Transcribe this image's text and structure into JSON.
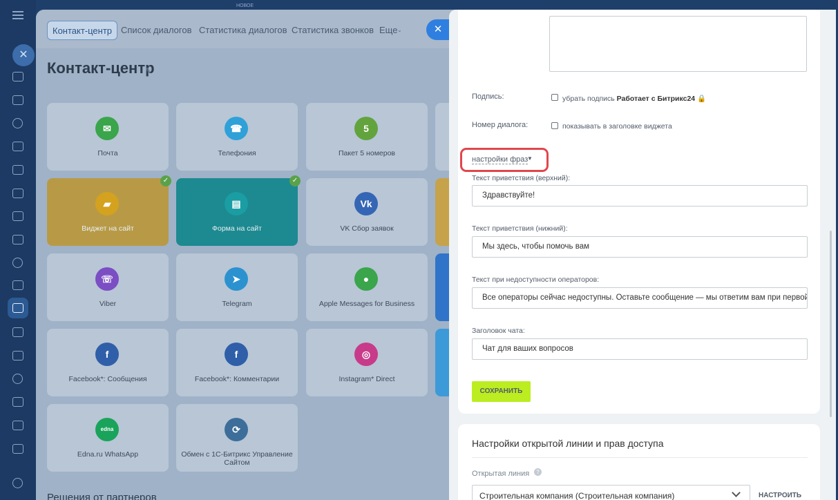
{
  "top_badge": "НОВОЕ",
  "tabs": [
    {
      "label": "Контакт-центр"
    },
    {
      "label": "Список диалогов"
    },
    {
      "label": "Статистика диалогов"
    },
    {
      "label": "Статистика звонков"
    },
    {
      "label": "Еще"
    }
  ],
  "page_title": "Контакт-центр",
  "tiles": [
    {
      "label": "Почта",
      "icon": "mail-icon",
      "icon_glyph": "✉",
      "color": "#3aa54a"
    },
    {
      "label": "Телефония",
      "icon": "phone-icon",
      "icon_glyph": "☎",
      "color": "#2fa0d8"
    },
    {
      "label": "Пакет 5 номеров",
      "icon": "numbers-package-icon",
      "icon_glyph": "5",
      "color": "#62a33e"
    },
    {
      "label": "Виджет на сайт",
      "icon": "chat-widget-icon",
      "icon_glyph": "▰",
      "color": "#d4a21e",
      "checked": true
    },
    {
      "label": "Форма на сайт",
      "icon": "form-icon",
      "icon_glyph": "▤",
      "color": "#1a9da3",
      "checked": true
    },
    {
      "label": "VK Сбор заявок",
      "icon": "vk-icon",
      "icon_glyph": "Vk",
      "color": "#3566b5"
    },
    {
      "label": "Viber",
      "icon": "viber-icon",
      "icon_glyph": "☏",
      "color": "#7b4ec4"
    },
    {
      "label": "Telegram",
      "icon": "telegram-icon",
      "icon_glyph": "➤",
      "color": "#2b92cf"
    },
    {
      "label": "Apple Messages for Business",
      "icon": "apple-messages-icon",
      "icon_glyph": "●",
      "color": "#3aa54a"
    },
    {
      "label": "Facebook*: Сообщения",
      "icon": "facebook-icon",
      "icon_glyph": "f",
      "color": "#2f5fa8"
    },
    {
      "label": "Facebook*: Комментарии",
      "icon": "facebook-comments-icon",
      "icon_glyph": "f",
      "color": "#2f5fa8"
    },
    {
      "label": "Instagram* Direct",
      "icon": "instagram-icon",
      "icon_glyph": "◎",
      "color": "#c83b8a"
    },
    {
      "label": "Edna.ru WhatsApp",
      "icon": "edna-icon",
      "icon_glyph": "edna",
      "color": "#1aa35a"
    },
    {
      "label": "Обмен с 1С-Битрикс Управление Сайтом",
      "icon": "bitrix-exchange-icon",
      "icon_glyph": "⟳",
      "color": "#3d6e9a"
    }
  ],
  "partners_heading": "Решения от партнеров",
  "form": {
    "signature_label": "Подпись:",
    "signature_checkbox_text": "убрать подпись",
    "signature_brand": "Работает с Битрикс24",
    "dialog_number_label": "Номер диалога:",
    "dialog_number_checkbox_text": "показывать в заголовке виджета",
    "phrases_link": "настройки фраз",
    "greeting_top_label": "Текст приветствия (верхний):",
    "greeting_top_value": "Здравствуйте!",
    "greeting_bottom_label": "Текст приветствия (нижний):",
    "greeting_bottom_value": "Мы здесь, чтобы помочь вам",
    "unavailable_label": "Текст при недоступности операторов:",
    "unavailable_value": "Все операторы сейчас недоступны. Оставьте сообщение — мы ответим вам при первой во",
    "chat_title_label": "Заголовок чата:",
    "chat_title_value": "Чат для ваших вопросов",
    "save_button": "СОХРАНИТЬ"
  },
  "access": {
    "title": "Настройки открытой линии и прав доступа",
    "open_line_label": "Открытая линия",
    "open_line_value": "Строительная компания (Строительная компания)",
    "configure_button": "НАСТРОИТЬ"
  }
}
